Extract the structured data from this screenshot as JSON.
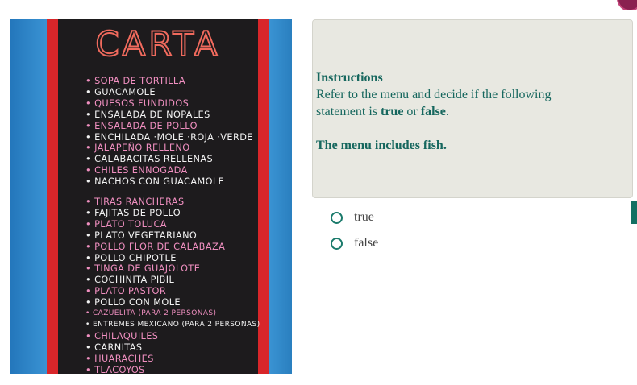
{
  "menu_image": {
    "title": "CARTA",
    "items_group_1": [
      {
        "text": "Sopa de tortilla",
        "color": "#f08fc0"
      },
      {
        "text": "Guacamole",
        "color": "#f2f2f2"
      },
      {
        "text": "Quesos fundidos",
        "color": "#f08fc0"
      },
      {
        "text": "Ensalada de nopales",
        "color": "#f2f2f2"
      },
      {
        "text": "Ensalada de pollo",
        "color": "#f08fc0"
      },
      {
        "text": "Enchilada ·mole ·roja ·verde",
        "color": "#f2f2f2"
      },
      {
        "text": "Jalapeño relleno",
        "color": "#f08fc0"
      },
      {
        "text": "Calabacitas rellenas",
        "color": "#f2f2f2"
      },
      {
        "text": "Chiles ennogada",
        "color": "#f08fc0"
      },
      {
        "text": "Nachos con guacamole",
        "color": "#f2f2f2"
      }
    ],
    "items_group_2": [
      {
        "text": "Tiras rancheras",
        "color": "#f08fc0"
      },
      {
        "text": "Fajitas de pollo",
        "color": "#f2f2f2"
      },
      {
        "text": "Plato Toluca",
        "color": "#f08fc0"
      },
      {
        "text": "Plato vegetariano",
        "color": "#f2f2f2"
      },
      {
        "text": "Pollo flor de calabaza",
        "color": "#f08fc0"
      },
      {
        "text": "Pollo chipotle",
        "color": "#f2f2f2"
      },
      {
        "text": "Tinga de guajolote",
        "color": "#f08fc0"
      },
      {
        "text": "Cochinita pibil",
        "color": "#f2f2f2"
      },
      {
        "text": "Plato pastor",
        "color": "#f08fc0"
      },
      {
        "text": "Pollo con mole",
        "color": "#f2f2f2"
      },
      {
        "text": "Cazuelita (para 2 personas)",
        "color": "#f08fc0"
      },
      {
        "text": "Entremes mexicano (para 2 personas)",
        "color": "#f2f2f2"
      },
      {
        "text": "Chilaquiles",
        "color": "#f08fc0"
      },
      {
        "text": "Carnitas",
        "color": "#f2f2f2"
      },
      {
        "text": "Huaraches",
        "color": "#f08fc0"
      },
      {
        "text": "Tlacoyos",
        "color": "#f08fc0"
      }
    ]
  },
  "instructions": {
    "heading": "Instructions",
    "line1": "Refer to the menu and decide if the following",
    "line2_prefix": "statement is ",
    "true_word": "true",
    "or_word": " or ",
    "false_word": "false",
    "line2_suffix": ".",
    "statement": "The menu includes fish."
  },
  "options": [
    {
      "label": "true"
    },
    {
      "label": "false"
    }
  ],
  "colors": {
    "accent": "#1a7a6b",
    "panel_bg": "#e8e8e1",
    "instruction_text": "#16675e"
  }
}
